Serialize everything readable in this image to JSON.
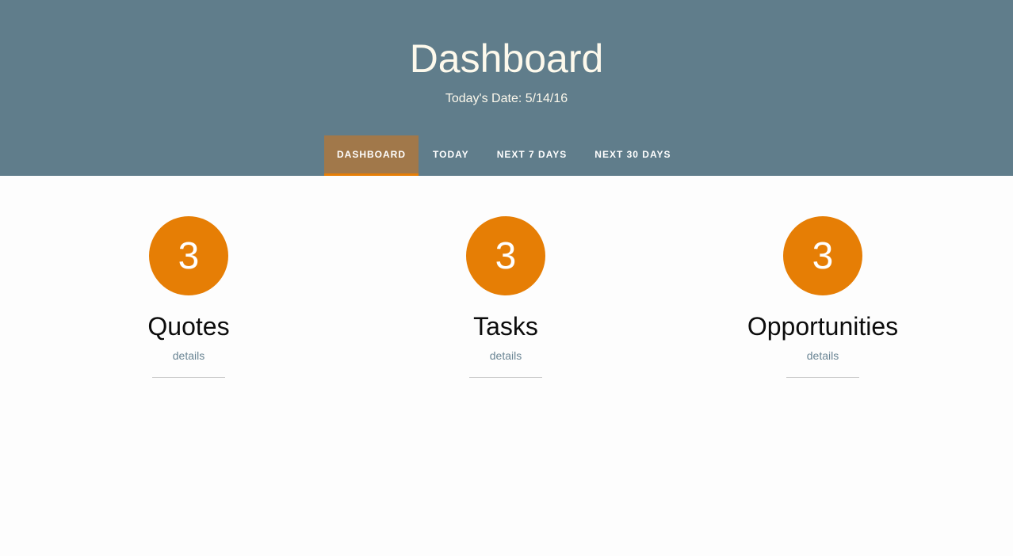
{
  "header": {
    "title": "Dashboard",
    "date_line": "Today's Date: 5/14/16",
    "background_color": "#607d8b",
    "title_color": "#fdf9ec"
  },
  "tabs": [
    {
      "label": "DASHBOARD",
      "active": true
    },
    {
      "label": "TODAY",
      "active": false
    },
    {
      "label": "NEXT 7 DAYS",
      "active": false
    },
    {
      "label": "NEXT 30 DAYS",
      "active": false
    }
  ],
  "cards": [
    {
      "count": "3",
      "title": "Quotes",
      "link": "details"
    },
    {
      "count": "3",
      "title": "Tasks",
      "link": "details"
    },
    {
      "count": "3",
      "title": "Opportunities",
      "link": "details"
    }
  ],
  "colors": {
    "accent": "#e67e05",
    "active_tab_background": "#a1784a",
    "link": "#6a8594"
  }
}
